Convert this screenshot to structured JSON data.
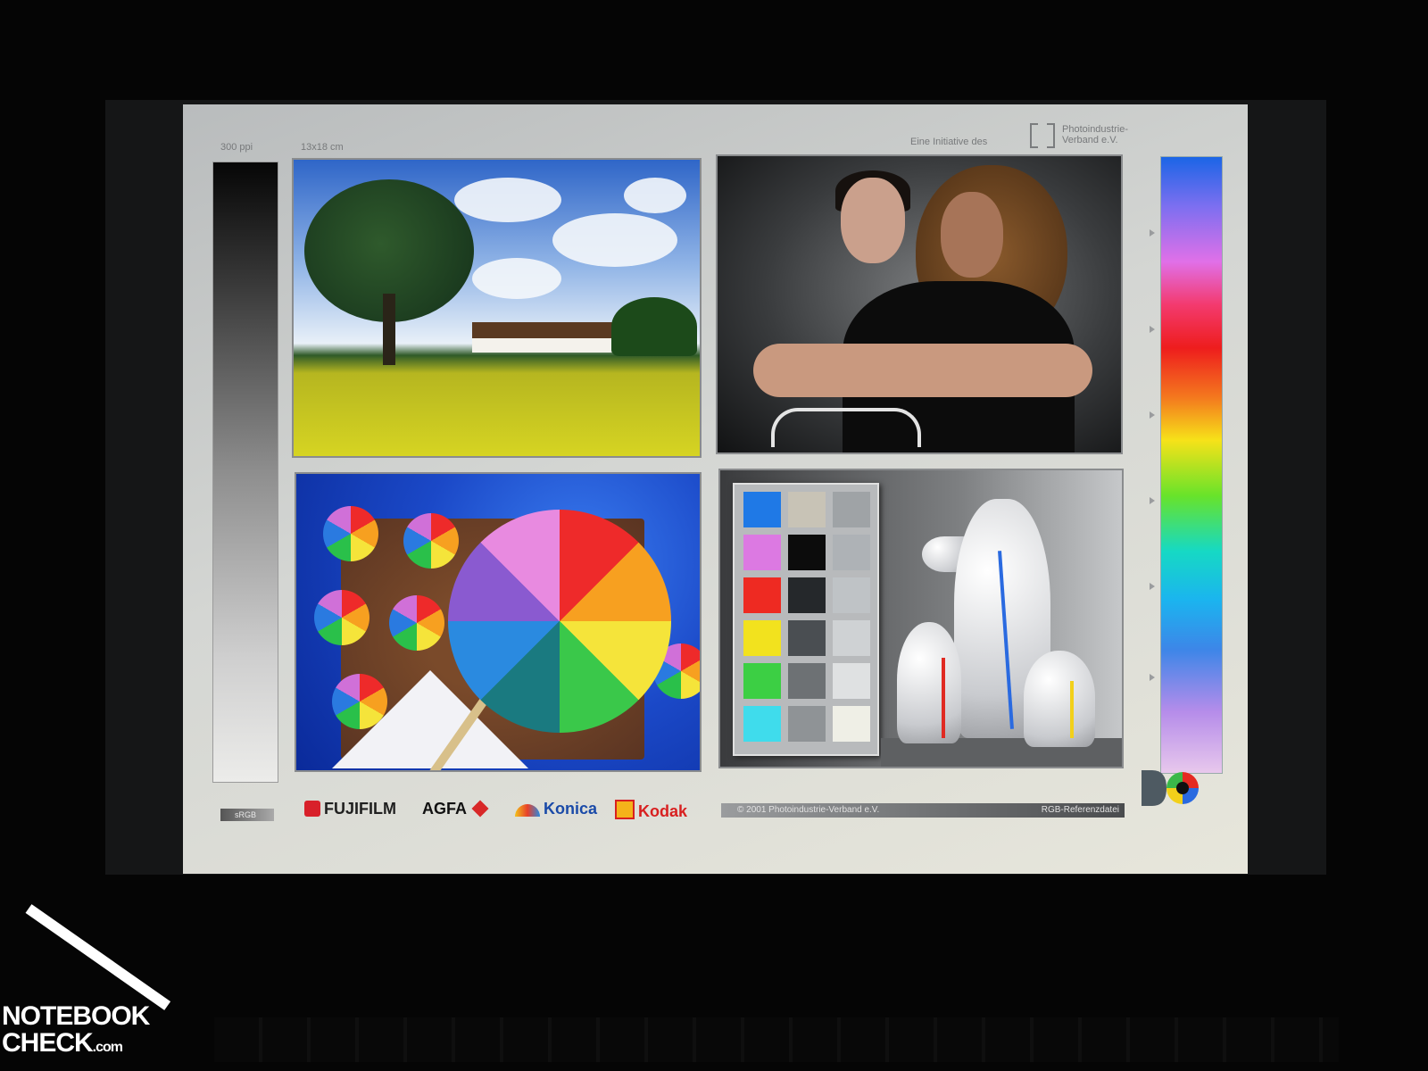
{
  "chart_sheet": {
    "resolution_label": "300 ppi",
    "size_label": "13x18 cm",
    "initiative_label": "Eine Initiative des",
    "publisher_line1": "Photoindustrie-",
    "publisher_line2": "Verband e.V.",
    "color_space_label": "sRGB",
    "copyright": "© 2001 Photoindustrie-Verband e.V.",
    "file_label": "RGB-Referenzdatei"
  },
  "brands": {
    "fujifilm": "FUJIFILM",
    "agfa": "AGFA",
    "konica": "Konica",
    "kodak": "Kodak"
  },
  "watermark": {
    "line1": "NOTEBOOK",
    "line2": "CHECK",
    "suffix": ".com"
  },
  "colors": {
    "fujifilm": "#d8202a",
    "agfa": "#111111",
    "konica": "#1a4aa8",
    "kodak": "#d82020"
  },
  "color_checker": [
    [
      "#1f79e6",
      "#c8c3b6",
      "#9fa3a6"
    ],
    [
      "#dc79e2",
      "#0c0c0c",
      "#aeb2b6"
    ],
    [
      "#ee2a22",
      "#25282b",
      "#bfc3c6"
    ],
    [
      "#f2e21e",
      "#4a4e52",
      "#cfd2d4"
    ],
    [
      "#3ccf44",
      "#6d7174",
      "#dfe1e2"
    ],
    [
      "#3fdcec",
      "#8f9396",
      "#efefe6"
    ]
  ]
}
